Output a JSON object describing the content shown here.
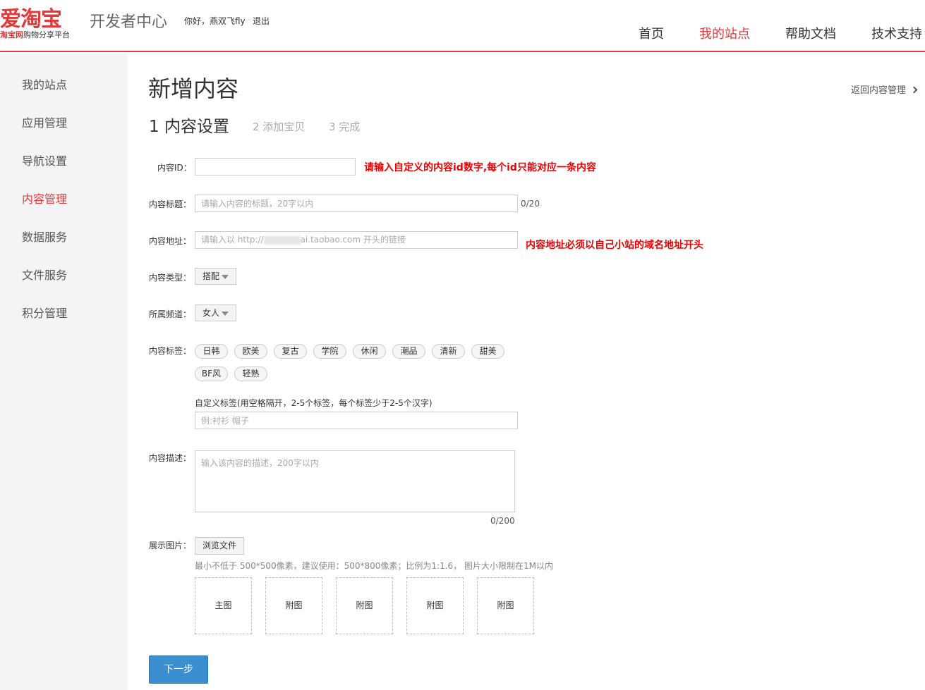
{
  "header": {
    "logo_text": "爱淘宝",
    "logo_sub_brand": "淘宝网",
    "logo_sub_text": "购物分享平台",
    "dev_center": "开发者中心",
    "greeting": "你好，燕双飞fly",
    "logout": "退出",
    "nav": [
      {
        "label": "首页",
        "active": false
      },
      {
        "label": "我的站点",
        "active": true
      },
      {
        "label": "帮助文档",
        "active": false
      },
      {
        "label": "技术支持",
        "active": false
      }
    ],
    "accent_color": "#e4393c"
  },
  "sidebar": {
    "items": [
      {
        "label": "我的站点",
        "active": false
      },
      {
        "label": "应用管理",
        "active": false
      },
      {
        "label": "导航设置",
        "active": false
      },
      {
        "label": "内容管理",
        "active": true
      },
      {
        "label": "数据服务",
        "active": false
      },
      {
        "label": "文件服务",
        "active": false
      },
      {
        "label": "积分管理",
        "active": false
      }
    ]
  },
  "main": {
    "title": "新增内容",
    "back_link": "返回内容管理",
    "steps": [
      {
        "label": "1 内容设置",
        "active": true
      },
      {
        "label": "2 添加宝贝",
        "active": false
      },
      {
        "label": "3 完成",
        "active": false
      }
    ],
    "form": {
      "content_id": {
        "label": "内容ID：",
        "value": "",
        "hint": "请输入自定义的内容id数字,每个id只能对应一条内容"
      },
      "content_title": {
        "label": "内容标题：",
        "placeholder": "请输入内容的标题，20字以内",
        "count": "0/20"
      },
      "content_url": {
        "label": "内容地址：",
        "placeholder_prefix": "请输入以 http://",
        "placeholder_suffix": "ai.taobao.com 开头的链接",
        "hint": "内容地址必须以自己小站的域名地址开头"
      },
      "content_type": {
        "label": "内容类型：",
        "selected": "搭配"
      },
      "channel": {
        "label": "所属频道：",
        "selected": "女人"
      },
      "tags": {
        "label": "内容标签：",
        "items": [
          "日韩",
          "欧美",
          "复古",
          "学院",
          "休闲",
          "潮品",
          "清新",
          "甜美",
          "BF风",
          "轻熟"
        ],
        "custom_label": "自定义标签(用空格隔开，2-5个标签，每个标签少于2-5个汉字)",
        "custom_placeholder": "例:衬衫 帽子"
      },
      "description": {
        "label": "内容描述：",
        "placeholder": "输入该内容的描述，200字以内",
        "count": "0/200"
      },
      "images": {
        "label": "展示图片：",
        "browse": "浏览文件",
        "hint": "最小不低于 500*500像素，建议使用：500*800像素；比例为1:1.6， 图片大小限制在1M以内",
        "slots": [
          "主图",
          "附图",
          "附图",
          "附图",
          "附图"
        ]
      }
    },
    "next_button": "下一步"
  }
}
